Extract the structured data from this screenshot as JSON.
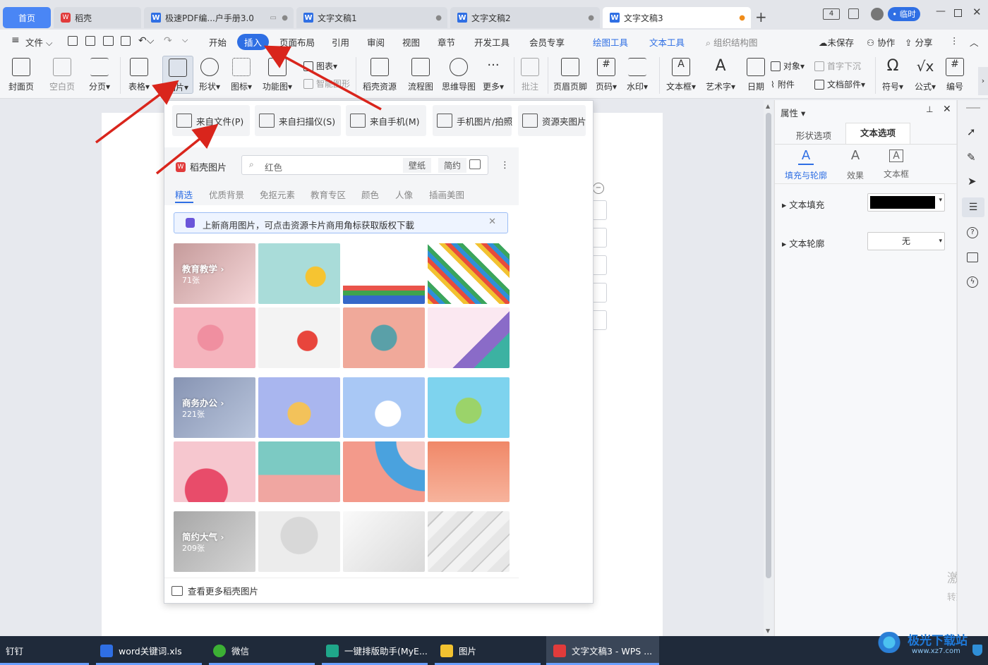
{
  "tabs": [
    {
      "label": "首页"
    },
    {
      "label": "稻壳"
    },
    {
      "label": "极速PDF编...户手册3.0"
    },
    {
      "label": "文字文稿1"
    },
    {
      "label": "文字文稿2"
    },
    {
      "label": "文字文稿3"
    }
  ],
  "titlebar": {
    "badge": "4",
    "user_label": "临时"
  },
  "menu": {
    "file": "文件",
    "items": [
      "开始",
      "插入",
      "页面布局",
      "引用",
      "审阅",
      "视图",
      "章节",
      "开发工具",
      "会员专享"
    ],
    "context": [
      "绘图工具",
      "文本工具"
    ],
    "search": "组织结构图",
    "unsaved": "未保存",
    "collab": "协作",
    "share": "分享"
  },
  "ribbon": {
    "cover": "封面页",
    "blank": "空白页",
    "pagebreak": "分页",
    "table": "表格",
    "picture": "图片",
    "shape": "形状",
    "icon": "图标",
    "funcchart": "功能图",
    "chart": "图表",
    "smartart": "智能图形",
    "docer": "稻壳资源",
    "flow": "流程图",
    "mind": "思维导图",
    "more": "更多",
    "comment": "批注",
    "header": "页眉页脚",
    "pagenum": "页码",
    "watermark": "水印",
    "textbox": "文本框",
    "wordart": "艺术字",
    "date": "日期",
    "object": "对象",
    "attach": "附件",
    "dropcap": "首字下沉",
    "docpart": "文档部件",
    "symbol": "符号",
    "formula": "公式",
    "numbering": "编号"
  },
  "popup": {
    "sources": [
      "来自文件(P)",
      "来自扫描仪(S)",
      "来自手机(M)",
      "手机图片/拍照",
      "资源夹图片"
    ],
    "brand": "稻壳图片",
    "search_value": "红色",
    "search_tags": [
      "壁纸",
      "简约"
    ],
    "tabs": [
      "精选",
      "优质背景",
      "免抠元素",
      "教育专区",
      "颜色",
      "人像",
      "插画美图"
    ],
    "notice": "上新商用图片，可点击资源卡片商用角标获取版权下載",
    "categories": [
      {
        "label": "教育教学",
        "count": "71张"
      },
      {
        "label": "商务办公",
        "count": "221张"
      },
      {
        "label": "简约大气",
        "count": "209张"
      }
    ],
    "footer": "查看更多稻壳图片"
  },
  "panel": {
    "title": "属性",
    "tabs": [
      "形状选项",
      "文本选项"
    ],
    "subtabs": [
      "填充与轮廓",
      "效果",
      "文本框"
    ],
    "fill_label": "文本填充",
    "fill_color": "#000000",
    "outline_label": "文本轮廓",
    "outline_value": "无"
  },
  "watermark": {
    "line1": "激活 W",
    "line2": "转到\"设置"
  },
  "taskbar": [
    {
      "label": "钉钉"
    },
    {
      "label": "word关键词.xls"
    },
    {
      "label": "微信"
    },
    {
      "label": "一键排版助手(MyE..."
    },
    {
      "label": "图片"
    },
    {
      "label": "文字文稿3 - WPS ..."
    }
  ],
  "site_logo": "极光下载站",
  "site_url": "www.xz7.com",
  "colors": {
    "accent": "#2f6fe4",
    "tab_active": "#4a86f5",
    "arrow": "#d9251c"
  }
}
